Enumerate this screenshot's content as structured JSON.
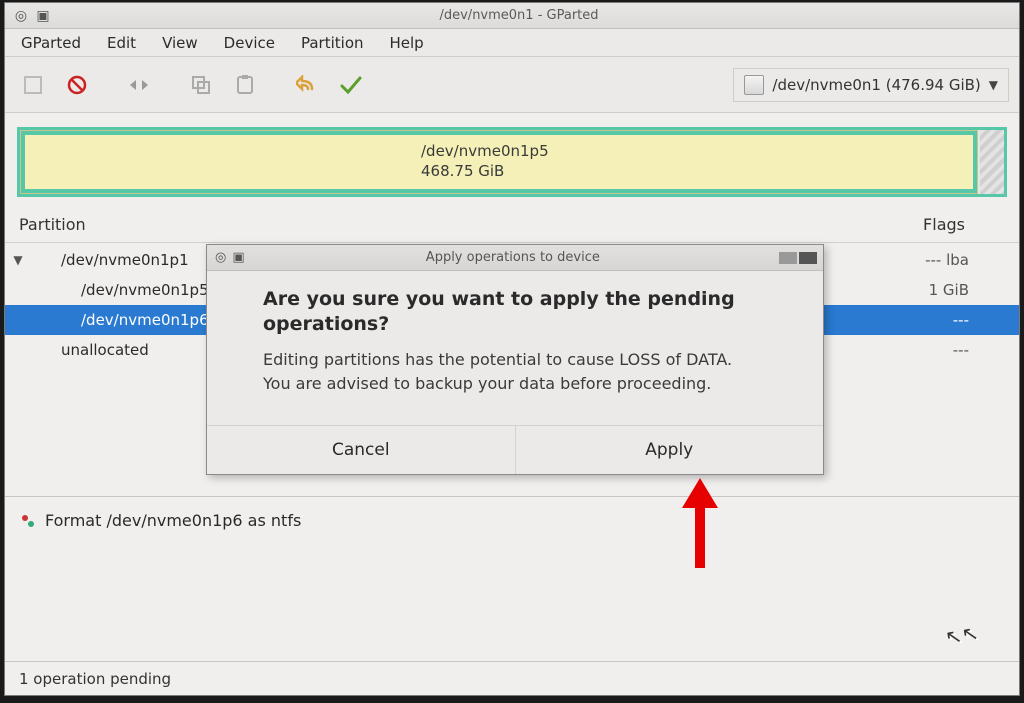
{
  "window": {
    "title": "/dev/nvme0n1 - GParted"
  },
  "menubar": {
    "items": [
      "GParted",
      "Edit",
      "View",
      "Device",
      "Partition",
      "Help"
    ]
  },
  "toolbar": {
    "icons": [
      "new-icon",
      "delete-icon",
      "resize-icon",
      "copy-icon",
      "paste-icon",
      "undo-icon",
      "apply-icon"
    ]
  },
  "device_selector": {
    "label": "/dev/nvme0n1 (476.94 GiB)"
  },
  "diskmap": {
    "partition_name": "/dev/nvme0n1p5",
    "partition_size": "468.75 GiB"
  },
  "columns": {
    "partition": "Partition",
    "flags": "Flags"
  },
  "tree": {
    "rows": [
      {
        "name": "/dev/nvme0n1p1",
        "flag": "--- lba"
      },
      {
        "name": "/dev/nvme0n1p5",
        "flag": "1 GiB"
      },
      {
        "name": "/dev/nvme0n1p6",
        "flag": "---"
      },
      {
        "name": "unallocated",
        "flag": "---"
      }
    ]
  },
  "operation": {
    "text": "Format /dev/nvme0n1p6 as ntfs"
  },
  "statusbar": {
    "text": "1 operation pending"
  },
  "dialog": {
    "title": "Apply operations to device",
    "heading": "Are you sure you want to apply the pending operations?",
    "body": "Editing partitions has the potential to cause LOSS of DATA.\nYou are advised to backup your data before proceeding.",
    "cancel": "Cancel",
    "apply": "Apply"
  }
}
